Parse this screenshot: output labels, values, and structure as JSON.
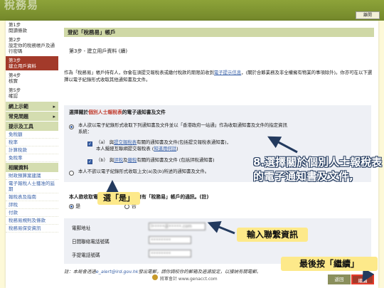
{
  "header": {
    "logo_fragment": "稅務易",
    "exit_button": "離開",
    "brand_color": "#7f9530"
  },
  "sidebar": {
    "steps": [
      {
        "num": "第1步",
        "label": "閱讀條款"
      },
      {
        "num": "第2步",
        "label": "設定你的稅務帳戶及通行密碼"
      },
      {
        "num": "第3步",
        "label": "建立用戶資料",
        "active": true
      },
      {
        "num": "第4步",
        "label": "核實"
      },
      {
        "num": "第5步",
        "label": "確認"
      }
    ],
    "nav": [
      {
        "label": "網上示範",
        "arrow": "▸"
      },
      {
        "label": "常見問題",
        "arrow": "▸"
      },
      {
        "label": "提示及工具"
      }
    ],
    "links_1": [
      "免稅額",
      "稅率",
      "計算稅款",
      "免稅率"
    ],
    "section": "相關資料",
    "links_2": [
      "財政預算案建議",
      "電子報稅人士獲准的延期",
      "報稅表及指南",
      "評稅",
      "付款",
      "稅務易規則及條款",
      "稅務易保安資訊"
    ]
  },
  "main": {
    "header": "登記「稅務易」帳戶",
    "subtitle": "第3步 - 建立用戶資料 (續)",
    "intro_pre": "作為「稅務易」帳戶持有人，你會在須提交報稅表或繳付稅款的期限前收到",
    "intro_link": "電子提示信息",
    "intro_post": "，(關於合夥業務及非全權擁有物業的事項除外)。你亦可在以下選擇以電子紀錄形式收取其他通知書及文件。",
    "choice_title_pre": "選擇關於",
    "choice_title_red": "個別人士報稅表",
    "choice_title_post": "的電子通知書及文件",
    "option_all": "本人欲以電子紀錄形式收取下列通知書及文件並以「香港政府一站通」作為收取通知書及文件的指定資訊系統：",
    "sub_a_pre": "（a） 與",
    "sub_a_link": "提交報稅表",
    "sub_a_post": "有關的通知書及文件(包括提交報稅表通知書)，",
    "sub_a_line2_pre": "本人擬經互聯網提交報稅表 (",
    "sub_a_line2_link": "知道用何話",
    "sub_a_line2_post": ")",
    "sub_b_pre": "（b） 與",
    "sub_b_link1": "評稅",
    "sub_b_mid": "及",
    "sub_b_link2": "繳稅",
    "sub_b_post": "有關的通知書及文件 (包括評稅通知書)",
    "option_none": "本人不欲以電子紀錄形式收取上文(a)及(b)所述的通知書及文件。",
    "notify_q": "本人欲收取電郵，通知本人在我擁有「稅務易」帳戶的通訊。(註)",
    "yes_label": "是",
    "no_label": "否",
    "email_label": "電郵地址",
    "phone_label": "日間聯絡電話號碼",
    "mobile_label": "手提電話號碼",
    "email_value": "l•••••@•••••.com",
    "phone_value": "••••••••",
    "mobile_value": "••••••••",
    "note_pre": "註：本局會透過",
    "note_link": "e_alert@ird.gov.hk",
    "note_post": "發出電郵，請你調校你的郵箱及過濾設定，以接納有關電郵。",
    "back_button": "返回",
    "next_button": "繼續"
  },
  "footer": {
    "credit": "將軍會計 www.genacct.com"
  },
  "annotations": {
    "select_docs": "8.選擇關於個別人士報稅表",
    "select_docs_2": "的電子通知書及文件,",
    "select_yes": "選「是」",
    "enter_contact": "輸入聯繫資訊",
    "press_next": "最後按「繼續」"
  }
}
